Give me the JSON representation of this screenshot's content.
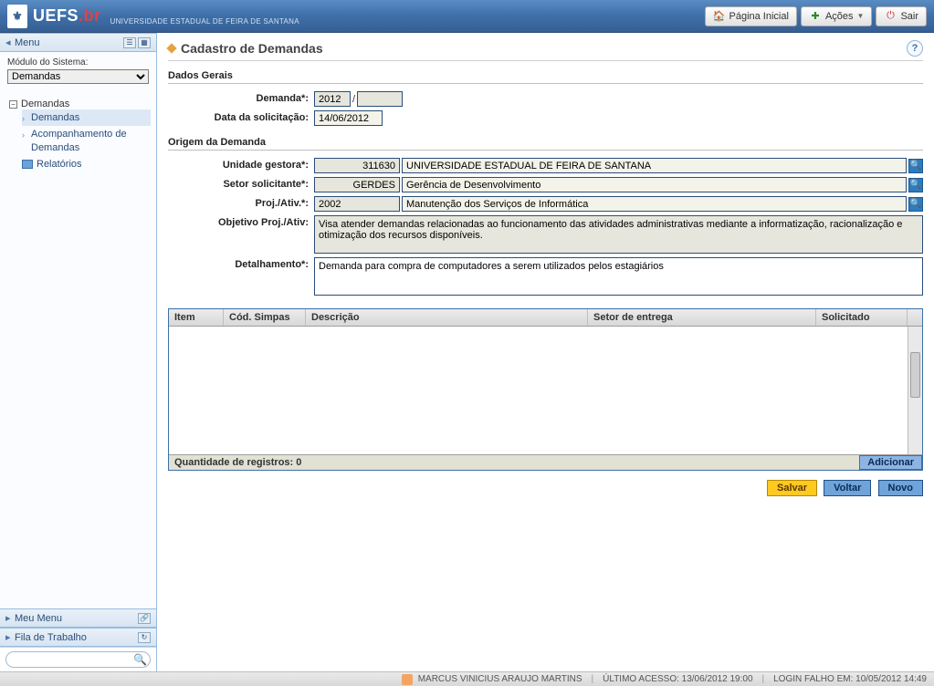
{
  "header": {
    "logo_main": "UEFS",
    "logo_suffix": ".br",
    "logo_sub": "UNIVERSIDADE ESTADUAL DE FEIRA DE SANTANA",
    "btn_home": "Página Inicial",
    "btn_actions": "Ações",
    "btn_exit": "Sair"
  },
  "sidebar": {
    "menu_title": "Menu",
    "module_label": "Módulo do Sistema:",
    "module_value": "Demandas",
    "tree_root": "Demandas",
    "tree_items": {
      "demandas": "Demandas",
      "acompanhamento": "Acompanhamento de Demandas",
      "relatorios": "Relatórios"
    },
    "meu_menu": "Meu Menu",
    "fila": "Fila de Trabalho",
    "search_placeholder": ""
  },
  "page": {
    "title": "Cadastro de Demandas",
    "section_dados": "Dados Gerais",
    "section_origem": "Origem da Demanda",
    "labels": {
      "demanda": "Demanda*:",
      "data_sol": "Data da solicitação:",
      "unidade": "Unidade gestora*:",
      "setor": "Setor solicitante*:",
      "proj": "Proj./Ativ.*:",
      "objetivo": "Objetivo Proj./Ativ:",
      "detalhamento": "Detalhamento*:"
    },
    "fields": {
      "demanda_ano": "2012",
      "demanda_sep": "/",
      "demanda_num": "",
      "data_sol": "14/06/2012",
      "unidade_cod": "311630",
      "unidade_desc": "UNIVERSIDADE ESTADUAL DE FEIRA DE SANTANA",
      "setor_cod": "GERDES",
      "setor_desc": "Gerência de Desenvolvimento",
      "proj_cod": "2002",
      "proj_desc": "Manutenção dos Serviços de Informática",
      "objetivo": "Visa atender demandas relacionadas ao funcionamento das atividades administrativas mediante a informatização, racionalização e otimização dos recursos disponíveis.",
      "detalhamento": "Demanda para compra de computadores a serem utilizados pelos estagiários"
    },
    "table": {
      "col_item": "Item",
      "col_cod": "Cód. Simpas",
      "col_desc": "Descrição",
      "col_setor": "Setor de entrega",
      "col_sol": "Solicitado",
      "footer_label": "Quantidade de registros: 0",
      "btn_add": "Adicionar"
    },
    "buttons": {
      "salvar": "Salvar",
      "voltar": "Voltar",
      "novo": "Novo"
    }
  },
  "status": {
    "user": "MARCUS VINICIUS ARAUJO MARTINS",
    "ultimo": "ÚLTIMO ACESSO: 13/06/2012 19:00",
    "login_falho": "LOGIN FALHO EM: 10/05/2012 14:49"
  }
}
